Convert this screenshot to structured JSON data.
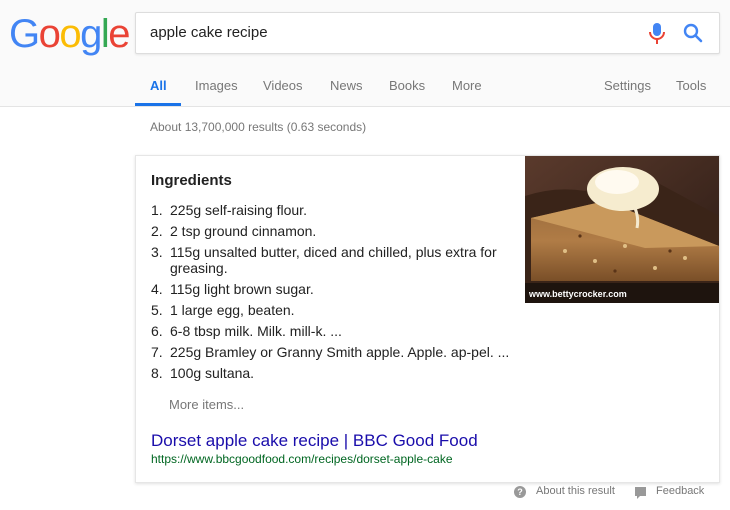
{
  "logo": {
    "letters": [
      "G",
      "o",
      "o",
      "g",
      "l",
      "e"
    ]
  },
  "search": {
    "query": "apple cake recipe",
    "mic_icon": "mic-icon",
    "search_icon": "search-icon"
  },
  "tabs": [
    {
      "label": "All",
      "active": true
    },
    {
      "label": "Images"
    },
    {
      "label": "Videos"
    },
    {
      "label": "News"
    },
    {
      "label": "Books"
    },
    {
      "label": "More"
    },
    {
      "label": "Settings"
    },
    {
      "label": "Tools"
    }
  ],
  "stats": "About 13,700,000 results (0.63 seconds)",
  "snippet": {
    "heading": "Ingredients",
    "items": [
      {
        "num": "1.",
        "text": "225g self-raising flour."
      },
      {
        "num": "2.",
        "text": "2 tsp ground cinnamon."
      },
      {
        "num": "3.",
        "text": "115g unsalted butter, diced and chilled, plus extra for greasing."
      },
      {
        "num": "4.",
        "text": "115g light brown sugar."
      },
      {
        "num": "5.",
        "text": "1 large egg, beaten."
      },
      {
        "num": "6.",
        "text": "6-8 tbsp milk. Milk. mill-k. ..."
      },
      {
        "num": "7.",
        "text": "225g Bramley or Granny Smith apple. Apple. ap-pel. ..."
      },
      {
        "num": "8.",
        "text": "100g sultana."
      }
    ],
    "more_items": "More items...",
    "result_title": "Dorset apple cake recipe | BBC Good Food",
    "result_url": "https://www.bbcgoodfood.com/recipes/dorset-apple-cake",
    "image_caption": "www.bettycrocker.com"
  },
  "footer": {
    "about": "About this result",
    "feedback": "Feedback"
  },
  "colors": {
    "link": "#1a0dab",
    "url": "#006621",
    "accent": "#1a73e8"
  }
}
